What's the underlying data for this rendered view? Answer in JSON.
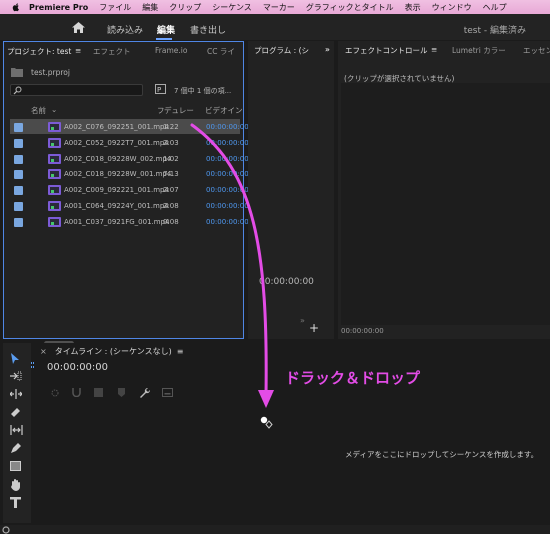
{
  "menubar": {
    "app": "Premiere Pro",
    "items": [
      "ファイル",
      "編集",
      "クリップ",
      "シーケンス",
      "マーカー",
      "グラフィックとタイトル",
      "表示",
      "ウィンドウ",
      "ヘルプ"
    ]
  },
  "workspace": {
    "tabs": [
      "読み込み",
      "編集",
      "書き出し"
    ],
    "active": "編集",
    "project_status": "test - 編集済み"
  },
  "project_panel": {
    "tabs": [
      "プロジェクト: test",
      "エフェクト",
      "Frame.io",
      "CC ライ"
    ],
    "project_file": "test.prproj",
    "search_placeholder": "",
    "item_count": "7 個中 1 個の項...",
    "columns": [
      "名前",
      "フレームレート",
      "デュレー",
      "ビデオイン"
    ],
    "rows": [
      {
        "name": "A002_C076_092251_001.mp4",
        "duration": "1:22",
        "video_in": "00:00:00:00",
        "selected": true
      },
      {
        "name": "A002_C052_0922T7_001.mp4",
        "duration": "2:03",
        "video_in": "00:00:00:00",
        "selected": false
      },
      {
        "name": "A002_C018_09228W_002.mp4",
        "duration": "1:02",
        "video_in": "00:00:00:00",
        "selected": false
      },
      {
        "name": "A002_C018_09228W_001.mp4",
        "duration": "7:13",
        "video_in": "00:00:00:00",
        "selected": false
      },
      {
        "name": "A002_C009_092221_001.mp4",
        "duration": "2:07",
        "video_in": "00:00:00:00",
        "selected": false
      },
      {
        "name": "A001_C064_09224Y_001.mp4",
        "duration": "2:08",
        "video_in": "00:00:00:00",
        "selected": false
      },
      {
        "name": "A001_C037_0921FG_001.mp4",
        "duration": "0:08",
        "video_in": "00:00:00:00",
        "selected": false
      }
    ]
  },
  "program_panel": {
    "tab": "プログラム : (シ",
    "timecode": "00:00:00:00"
  },
  "effect_controls": {
    "tabs": [
      "エフェクトコントロール",
      "Lumetri カラー",
      "エッセン"
    ],
    "empty_note": "(クリップが選択されていません)",
    "timecode": "00:00:00:00"
  },
  "timeline": {
    "title": "タイムライン : (シーケンスなし)",
    "timecode": "00:00:00:00",
    "empty_message": "メディアをここにドロップしてシーケンスを作成します。"
  },
  "annotation": {
    "text": "ドラック＆ドロップ",
    "color": "#e34ce6"
  },
  "colors": {
    "accent_blue": "#4f86e5",
    "timecode_blue": "#4f98f0",
    "menubar_pink": "#eab0da"
  }
}
